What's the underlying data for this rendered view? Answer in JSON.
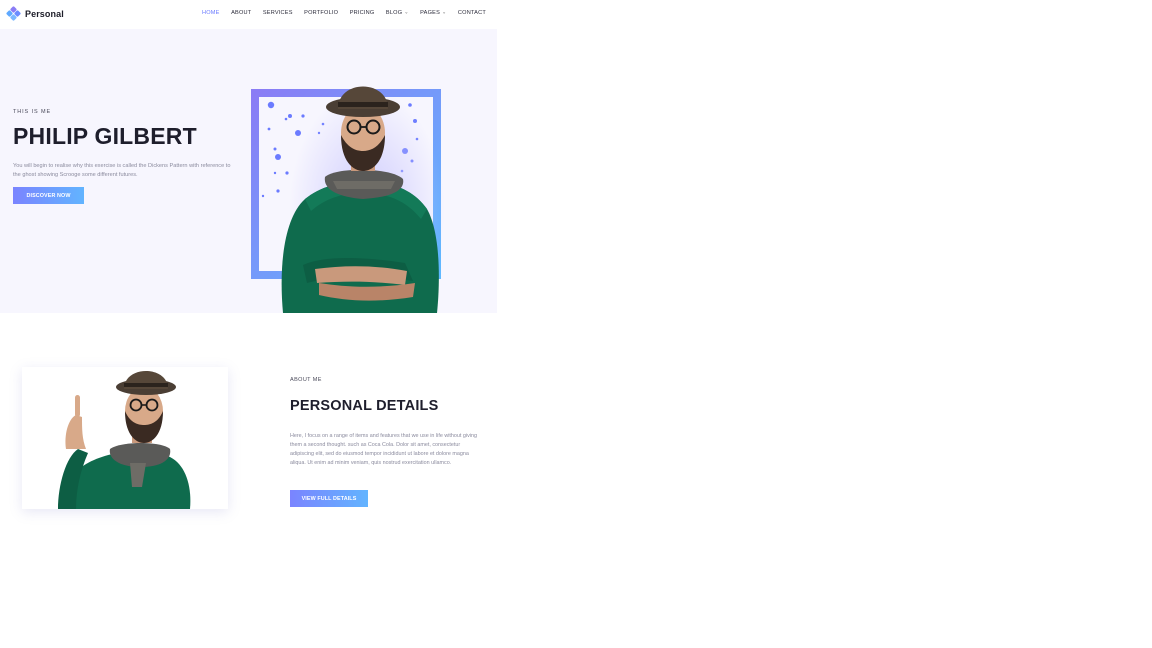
{
  "header": {
    "logo_text": "Personal",
    "nav": [
      {
        "label": "HOME",
        "active": true,
        "dropdown": false
      },
      {
        "label": "ABOUT",
        "active": false,
        "dropdown": false
      },
      {
        "label": "SERVICES",
        "active": false,
        "dropdown": false
      },
      {
        "label": "PORTFOLIO",
        "active": false,
        "dropdown": false
      },
      {
        "label": "PRICING",
        "active": false,
        "dropdown": false
      },
      {
        "label": "BLOG",
        "active": false,
        "dropdown": true
      },
      {
        "label": "PAGES",
        "active": false,
        "dropdown": true
      },
      {
        "label": "CONTACT",
        "active": false,
        "dropdown": false
      }
    ],
    "dropdown_glyph": "⌄"
  },
  "hero": {
    "eyebrow": "THIS IS ME",
    "title": "PHILIP GILBERT",
    "description": "You will begin to realise why this exercise is called the Dickens Pattern with reference to the ghost showing Scrooge some different futures.",
    "cta_label": "DISCOVER NOW"
  },
  "about": {
    "eyebrow": "ABOUT ME",
    "title": "PERSONAL DETAILS",
    "description": "Here, I focus on a range of items and features that we use in life without giving them a second thought. such as Coca Cola. Dolor sit amet, consectetur adipiscing elit, sed do eiusmod tempor incididunt ut labore et dolore magna aliqua. Ut enim ad minim veniam, quis nostrud exercitation ullamco.",
    "cta_label": "VIEW FULL DETAILS"
  },
  "colors": {
    "accent": "#6b7bff",
    "gradient_start": "#7a84ff",
    "gradient_end": "#62b4ff",
    "hero_bg": "#f7f6fe",
    "sweater": "#0f6b4d",
    "heading": "#1e1e2c"
  },
  "icons": {
    "logo": "diamond-cluster-icon",
    "dropdown": "chevron-down-icon"
  }
}
